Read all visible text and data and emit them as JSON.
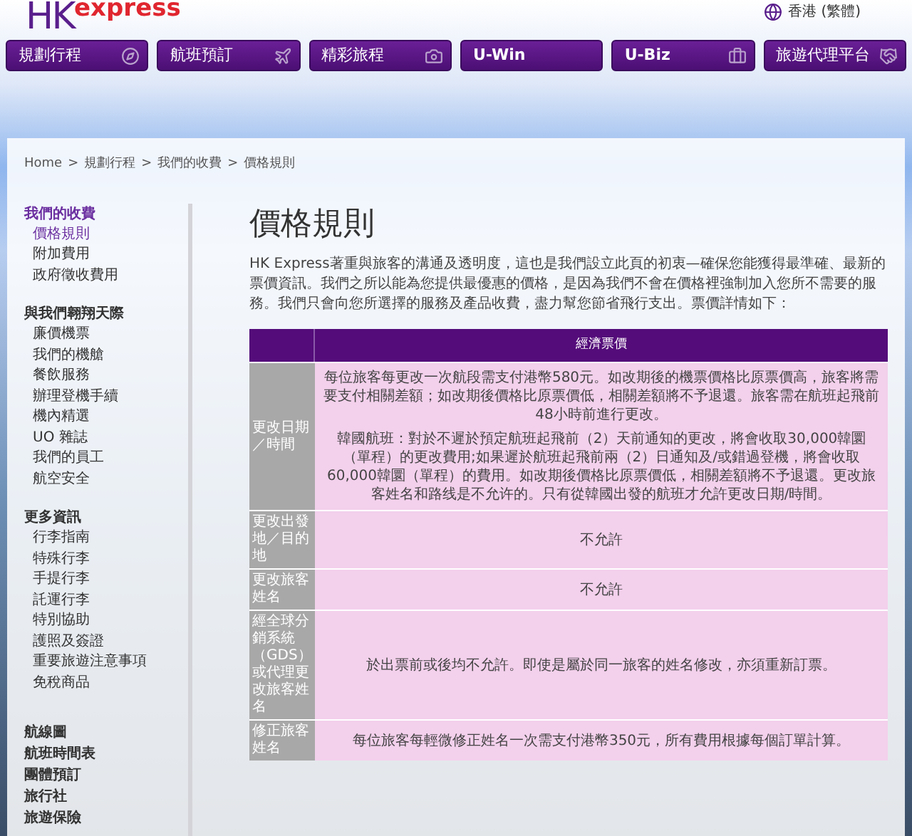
{
  "logo": {
    "brand": "HK",
    "word": "express"
  },
  "language": "香港 (繁體)",
  "nav": [
    {
      "label": "規劃行程"
    },
    {
      "label": "航班預訂"
    },
    {
      "label": "精彩旅程"
    },
    {
      "label": "U-Win"
    },
    {
      "label": "U-Biz"
    },
    {
      "label": "旅遊代理平台"
    }
  ],
  "breadcrumb": [
    "Home",
    "規劃行程",
    "我們的收費",
    "價格規則"
  ],
  "breadcrumb_separator": ">",
  "sidebar": [
    {
      "heading": "我們的收費",
      "selected": true,
      "items": [
        {
          "label": "價格規則",
          "selected": true
        },
        {
          "label": "附加費用",
          "selected": false
        },
        {
          "label": "政府徵收費用",
          "selected": false
        }
      ]
    },
    {
      "heading": "與我們翱翔天際",
      "selected": false,
      "items": [
        {
          "label": "廉價機票",
          "selected": false
        },
        {
          "label": "我們的機艙",
          "selected": false
        },
        {
          "label": "餐飲服務",
          "selected": false
        },
        {
          "label": "辦理登機手續",
          "selected": false
        },
        {
          "label": "機內精選",
          "selected": false
        },
        {
          "label": "UO 雜誌",
          "selected": false
        },
        {
          "label": "我們的員工",
          "selected": false
        },
        {
          "label": "航空安全",
          "selected": false
        }
      ]
    },
    {
      "heading": "更多資訊",
      "selected": false,
      "items": [
        {
          "label": "行李指南",
          "selected": false
        },
        {
          "label": "特殊行李",
          "selected": false
        },
        {
          "label": "手提行李",
          "selected": false
        },
        {
          "label": "託運行李",
          "selected": false
        },
        {
          "label": "特別協助",
          "selected": false
        },
        {
          "label": "護照及簽證",
          "selected": false
        },
        {
          "label": "重要旅遊注意事項",
          "selected": false
        },
        {
          "label": "免稅商品",
          "selected": false
        }
      ]
    }
  ],
  "sidebar_links": [
    "航線圖",
    "航班時間表",
    "團體預訂",
    "旅行社",
    "旅遊保險"
  ],
  "title": "價格規則",
  "intro": "HK Express著重與旅客的溝通及透明度，這也是我們設立此頁的初衷—確保您能獲得最準確、最新的票價資訊。我們之所以能為您提供最優惠的價格，是因為我們不會在價格裡強制加入您所不需要的服務。我們只會向您所選擇的服務及產品收費，盡力幫您節省飛行支出。票價詳情如下：",
  "table": {
    "columns": [
      "經濟票價"
    ],
    "rows": [
      {
        "label": "更改日期／時間",
        "paragraphs": [
          "每位旅客每更改一次航段需支付港幣580元。如改期後的機票價格比原票價高，旅客將需要支付相關差額；如改期後價格比原票價低，相關差額將不予退還。旅客需在航班起飛前48小時前進行更改。",
          "韓國航班：對於不遲於預定航班起飛前（2）天前通知的更改，將會收取30,000韓圜（單程）的更改費用;如果遲於航班起飛前兩（2）日通知及/或錯過登機，將會收取60,000韓圜（單程）的費用。如改期後價格比原票價低，相關差額將不予退還。更改旅客姓名和路线是不允许的。只有從韓國出發的航班才允許更改日期/時間。"
        ]
      },
      {
        "label": "更改出發地／目的地",
        "paragraphs": [
          "不允許"
        ]
      },
      {
        "label": "更改旅客姓名",
        "paragraphs": [
          "不允許"
        ]
      },
      {
        "label": "經全球分銷系統（GDS）或代理更改旅客姓名",
        "paragraphs": [
          "於出票前或後均不允許。即使是屬於同一旅客的姓名修改，亦須重新訂票。"
        ]
      },
      {
        "label": "修正旅客姓名",
        "paragraphs": [
          "每位旅客每輕微修正姓名一次需支付港幣350元，所有費用根據每個訂單計算。"
        ]
      }
    ]
  }
}
